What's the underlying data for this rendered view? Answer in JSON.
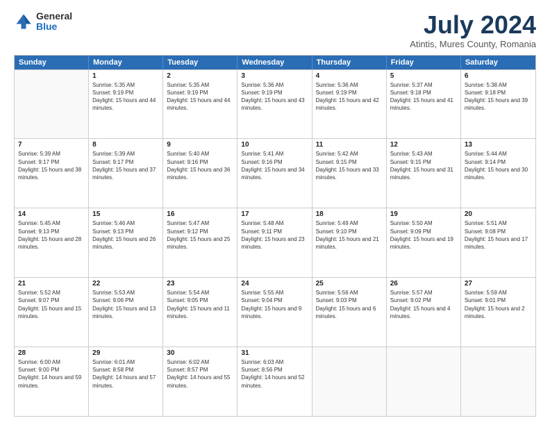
{
  "logo": {
    "general": "General",
    "blue": "Blue"
  },
  "title": "July 2024",
  "subtitle": "Atintis, Mures County, Romania",
  "weekdays": [
    "Sunday",
    "Monday",
    "Tuesday",
    "Wednesday",
    "Thursday",
    "Friday",
    "Saturday"
  ],
  "weeks": [
    [
      {
        "day": "",
        "empty": true
      },
      {
        "day": "1",
        "sunrise": "5:35 AM",
        "sunset": "9:19 PM",
        "daylight": "15 hours and 44 minutes."
      },
      {
        "day": "2",
        "sunrise": "5:35 AM",
        "sunset": "9:19 PM",
        "daylight": "15 hours and 44 minutes."
      },
      {
        "day": "3",
        "sunrise": "5:36 AM",
        "sunset": "9:19 PM",
        "daylight": "15 hours and 43 minutes."
      },
      {
        "day": "4",
        "sunrise": "5:36 AM",
        "sunset": "9:19 PM",
        "daylight": "15 hours and 42 minutes."
      },
      {
        "day": "5",
        "sunrise": "5:37 AM",
        "sunset": "9:18 PM",
        "daylight": "15 hours and 41 minutes."
      },
      {
        "day": "6",
        "sunrise": "5:38 AM",
        "sunset": "9:18 PM",
        "daylight": "15 hours and 39 minutes."
      }
    ],
    [
      {
        "day": "7",
        "sunrise": "5:39 AM",
        "sunset": "9:17 PM",
        "daylight": "15 hours and 38 minutes."
      },
      {
        "day": "8",
        "sunrise": "5:39 AM",
        "sunset": "9:17 PM",
        "daylight": "15 hours and 37 minutes."
      },
      {
        "day": "9",
        "sunrise": "5:40 AM",
        "sunset": "9:16 PM",
        "daylight": "15 hours and 36 minutes."
      },
      {
        "day": "10",
        "sunrise": "5:41 AM",
        "sunset": "9:16 PM",
        "daylight": "15 hours and 34 minutes."
      },
      {
        "day": "11",
        "sunrise": "5:42 AM",
        "sunset": "9:15 PM",
        "daylight": "15 hours and 33 minutes."
      },
      {
        "day": "12",
        "sunrise": "5:43 AM",
        "sunset": "9:15 PM",
        "daylight": "15 hours and 31 minutes."
      },
      {
        "day": "13",
        "sunrise": "5:44 AM",
        "sunset": "9:14 PM",
        "daylight": "15 hours and 30 minutes."
      }
    ],
    [
      {
        "day": "14",
        "sunrise": "5:45 AM",
        "sunset": "9:13 PM",
        "daylight": "15 hours and 28 minutes."
      },
      {
        "day": "15",
        "sunrise": "5:46 AM",
        "sunset": "9:13 PM",
        "daylight": "15 hours and 26 minutes."
      },
      {
        "day": "16",
        "sunrise": "5:47 AM",
        "sunset": "9:12 PM",
        "daylight": "15 hours and 25 minutes."
      },
      {
        "day": "17",
        "sunrise": "5:48 AM",
        "sunset": "9:11 PM",
        "daylight": "15 hours and 23 minutes."
      },
      {
        "day": "18",
        "sunrise": "5:49 AM",
        "sunset": "9:10 PM",
        "daylight": "15 hours and 21 minutes."
      },
      {
        "day": "19",
        "sunrise": "5:50 AM",
        "sunset": "9:09 PM",
        "daylight": "15 hours and 19 minutes."
      },
      {
        "day": "20",
        "sunrise": "5:51 AM",
        "sunset": "9:08 PM",
        "daylight": "15 hours and 17 minutes."
      }
    ],
    [
      {
        "day": "21",
        "sunrise": "5:52 AM",
        "sunset": "9:07 PM",
        "daylight": "15 hours and 15 minutes."
      },
      {
        "day": "22",
        "sunrise": "5:53 AM",
        "sunset": "9:06 PM",
        "daylight": "15 hours and 13 minutes."
      },
      {
        "day": "23",
        "sunrise": "5:54 AM",
        "sunset": "9:05 PM",
        "daylight": "15 hours and 11 minutes."
      },
      {
        "day": "24",
        "sunrise": "5:55 AM",
        "sunset": "9:04 PM",
        "daylight": "15 hours and 9 minutes."
      },
      {
        "day": "25",
        "sunrise": "5:56 AM",
        "sunset": "9:03 PM",
        "daylight": "15 hours and 6 minutes."
      },
      {
        "day": "26",
        "sunrise": "5:57 AM",
        "sunset": "9:02 PM",
        "daylight": "15 hours and 4 minutes."
      },
      {
        "day": "27",
        "sunrise": "5:59 AM",
        "sunset": "9:01 PM",
        "daylight": "15 hours and 2 minutes."
      }
    ],
    [
      {
        "day": "28",
        "sunrise": "6:00 AM",
        "sunset": "9:00 PM",
        "daylight": "14 hours and 59 minutes."
      },
      {
        "day": "29",
        "sunrise": "6:01 AM",
        "sunset": "8:58 PM",
        "daylight": "14 hours and 57 minutes."
      },
      {
        "day": "30",
        "sunrise": "6:02 AM",
        "sunset": "8:57 PM",
        "daylight": "14 hours and 55 minutes."
      },
      {
        "day": "31",
        "sunrise": "6:03 AM",
        "sunset": "8:56 PM",
        "daylight": "14 hours and 52 minutes."
      },
      {
        "day": "",
        "empty": true
      },
      {
        "day": "",
        "empty": true
      },
      {
        "day": "",
        "empty": true
      }
    ]
  ]
}
